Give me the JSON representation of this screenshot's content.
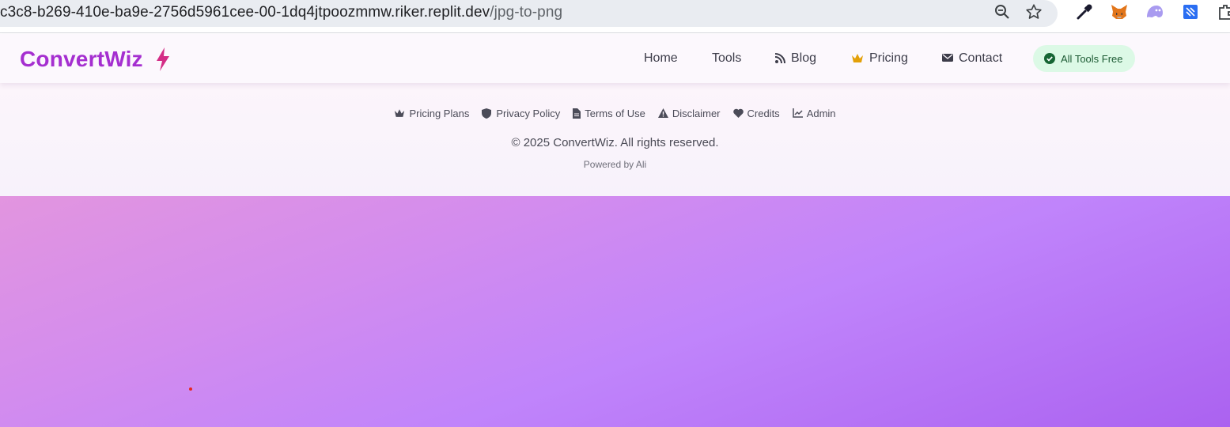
{
  "browser": {
    "url_host": "c3c8-b269-410e-ba9e-2756d5961cee-00-1dq4jtpoozmmw.riker.replit.dev",
    "url_path": "/jpg-to-png",
    "icons": [
      "zoom-icon",
      "star-icon",
      "eyedropper-extension-icon",
      "metamask-extension-icon",
      "ghost-extension-icon",
      "bookmark-extension-icon",
      "extensions-icon"
    ]
  },
  "header": {
    "logo": "ConvertWiz",
    "nav": {
      "home": "Home",
      "tools": "Tools",
      "blog": "Blog",
      "pricing": "Pricing",
      "contact": "Contact"
    },
    "badge": "All Tools Free",
    "colors": {
      "brand": "#a52fd0",
      "bolt": "#d42d86",
      "crown": "#e3a008",
      "badge_bg": "#dcf9e6"
    }
  },
  "footer": {
    "links": {
      "pricing_plans": "Pricing Plans",
      "privacy": "Privacy Policy",
      "terms": "Terms of Use",
      "disclaimer": "Disclaimer",
      "credits": "Credits",
      "admin": "Admin"
    },
    "copyright": "© 2025 ConvertWiz. All rights reserved.",
    "powered_by": "Powered by Ali"
  }
}
